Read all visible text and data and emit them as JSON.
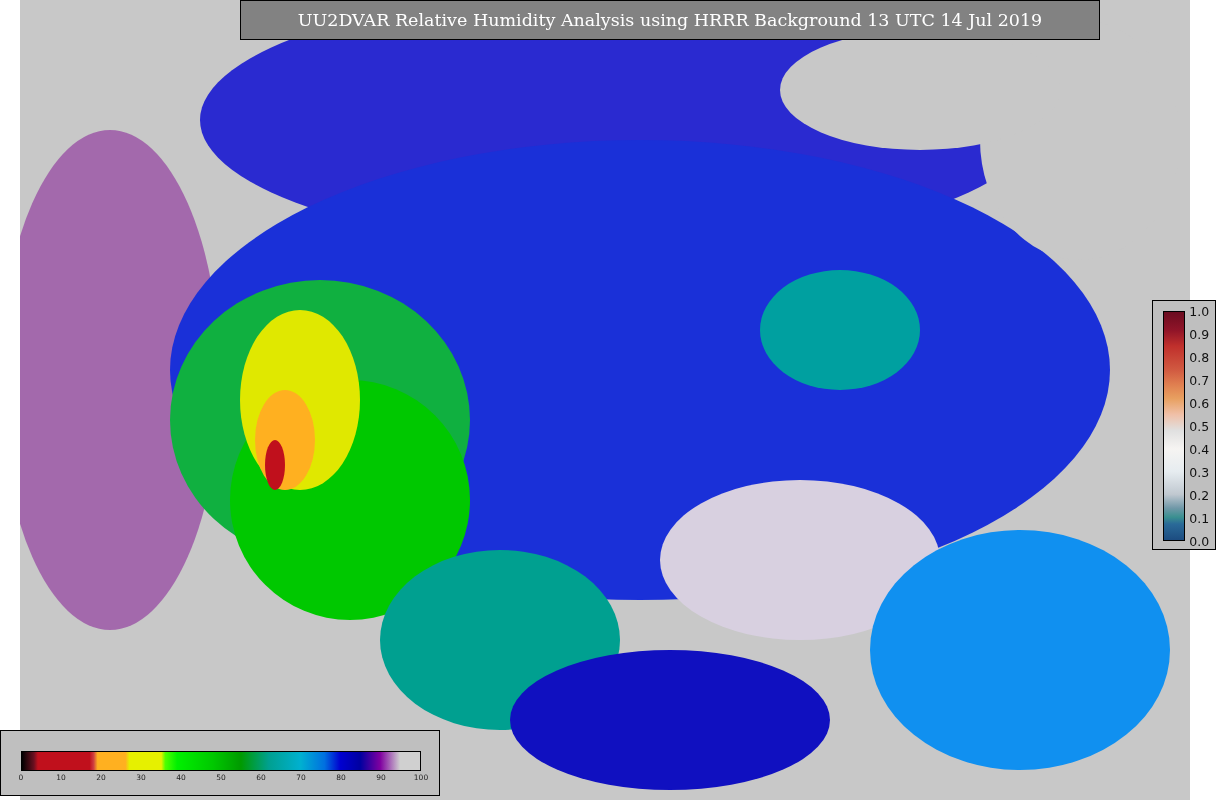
{
  "title": "UU2DVAR Relative Humidity Analysis using HRRR Background 13 UTC 14 Jul 2019",
  "humidity_colorbar": {
    "ticks": [
      "0",
      "10",
      "20",
      "30",
      "40",
      "50",
      "60",
      "70",
      "80",
      "90",
      "100"
    ]
  },
  "observation_colorbar": {
    "ticks": [
      "1.0",
      "0.9",
      "0.8",
      "0.7",
      "0.6",
      "0.5",
      "0.4",
      "0.3",
      "0.2",
      "0.1",
      "0.0"
    ]
  }
}
